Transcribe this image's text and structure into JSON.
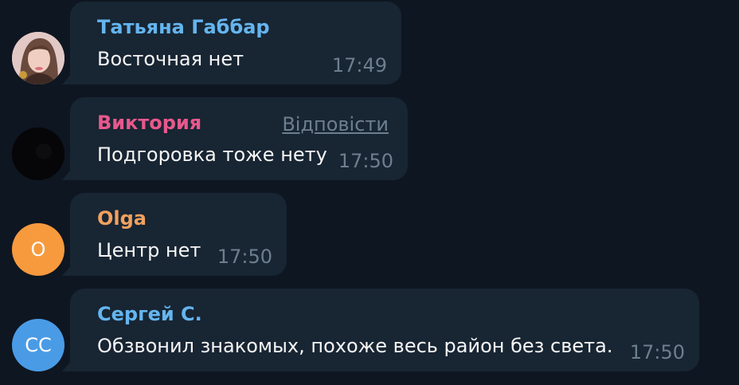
{
  "messages": [
    {
      "sender": "Татьяна Габбар",
      "sender_color": "#64b5ef",
      "text": "Восточная нет",
      "time": "17:49",
      "avatar": {
        "type": "photo",
        "icon": "user-photo-icon"
      }
    },
    {
      "sender": "Виктория",
      "sender_color": "#e8588d",
      "text": "Подгоровка тоже нету",
      "time": "17:50",
      "reply_label": "Відповісти",
      "avatar": {
        "type": "photo-dark",
        "icon": "user-photo-icon"
      }
    },
    {
      "sender": "Olga",
      "sender_color": "#f0a15e",
      "text": "Центр нет",
      "time": "17:50",
      "avatar": {
        "type": "initials",
        "initials": "O",
        "color": "#f79a3e"
      }
    },
    {
      "sender": "Сергей С.",
      "sender_color": "#64b5ef",
      "text": "Обзвонил знакомых, похоже весь район без света.",
      "time": "17:50",
      "avatar": {
        "type": "initials",
        "initials": "CC",
        "color": "#4a9be6"
      }
    }
  ]
}
